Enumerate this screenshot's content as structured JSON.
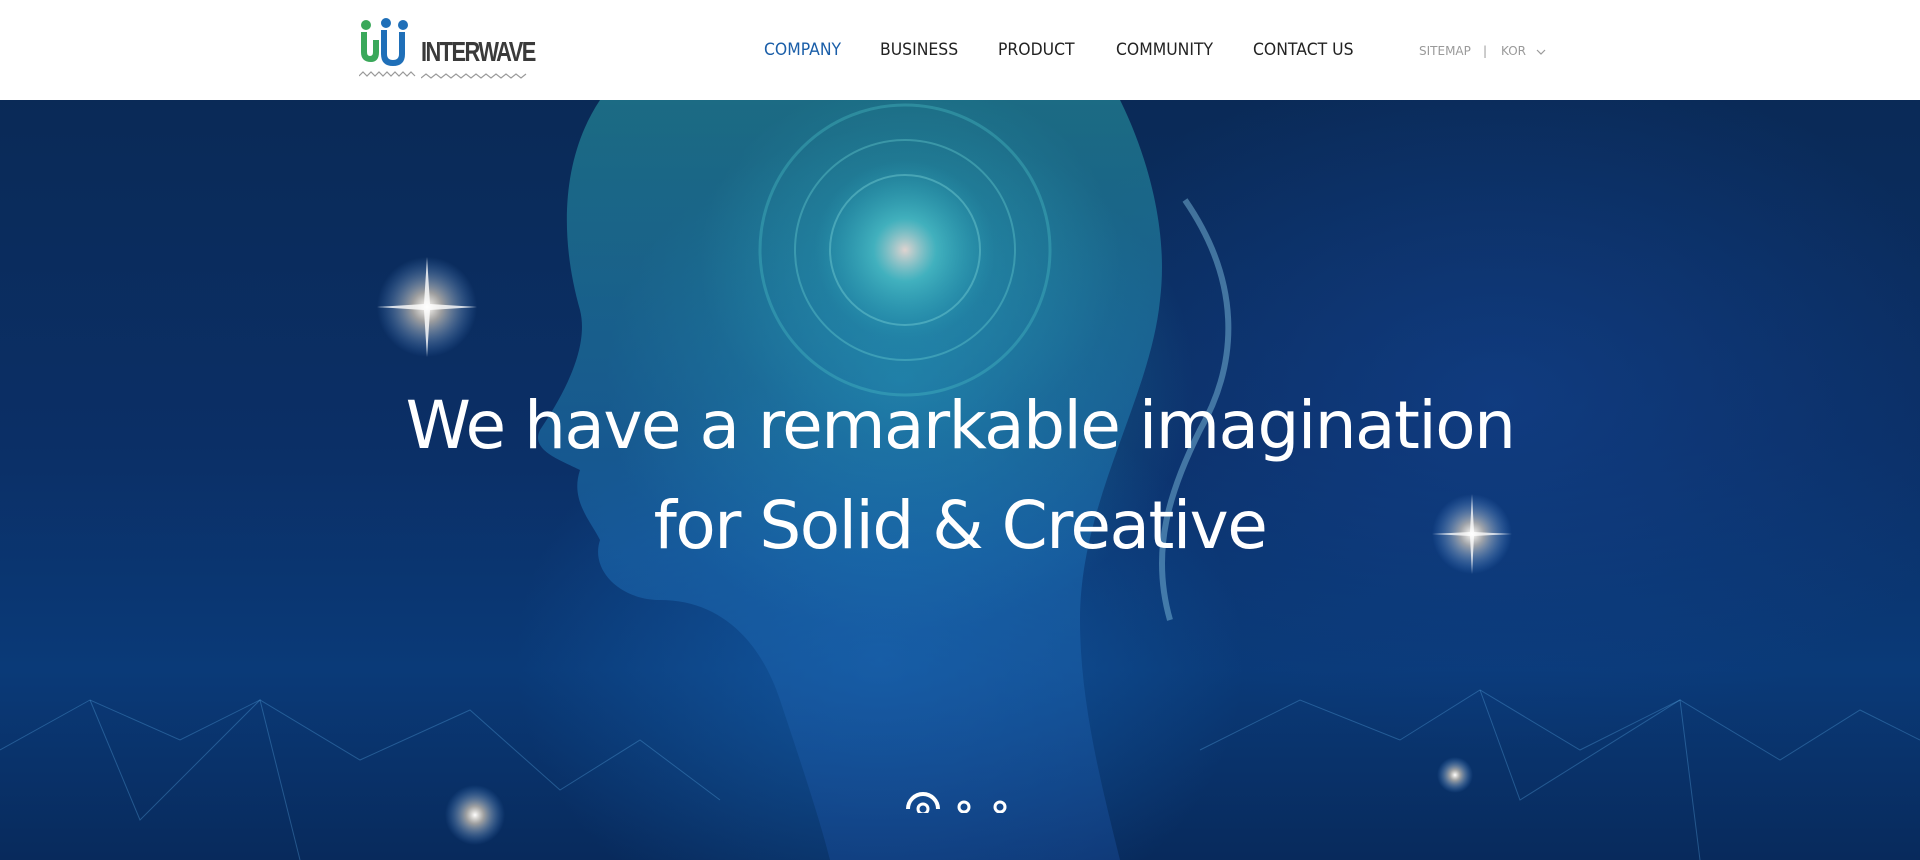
{
  "brand": {
    "logo_text": "INTERWAVE"
  },
  "nav": {
    "items": [
      {
        "label": "COMPANY",
        "active": true
      },
      {
        "label": "BUSINESS",
        "active": false
      },
      {
        "label": "PRODUCT",
        "active": false
      },
      {
        "label": "COMMUNITY",
        "active": false
      },
      {
        "label": "CONTACT US",
        "active": false
      }
    ]
  },
  "utility": {
    "sitemap_label": "SITEMAP",
    "divider": "|",
    "language": "KOR",
    "language_icon": "chevron-down-icon"
  },
  "hero": {
    "headline_line1": "We have a remarkable imagination",
    "headline_line2": "for Solid & Creative"
  },
  "slider": {
    "slide_count": 3,
    "active_index": 0
  },
  "colors": {
    "accent": "#1a5ea8",
    "logo_green": "#3aa85a",
    "logo_blue": "#1f6fb8",
    "hero_dark": "#0a2a57"
  }
}
